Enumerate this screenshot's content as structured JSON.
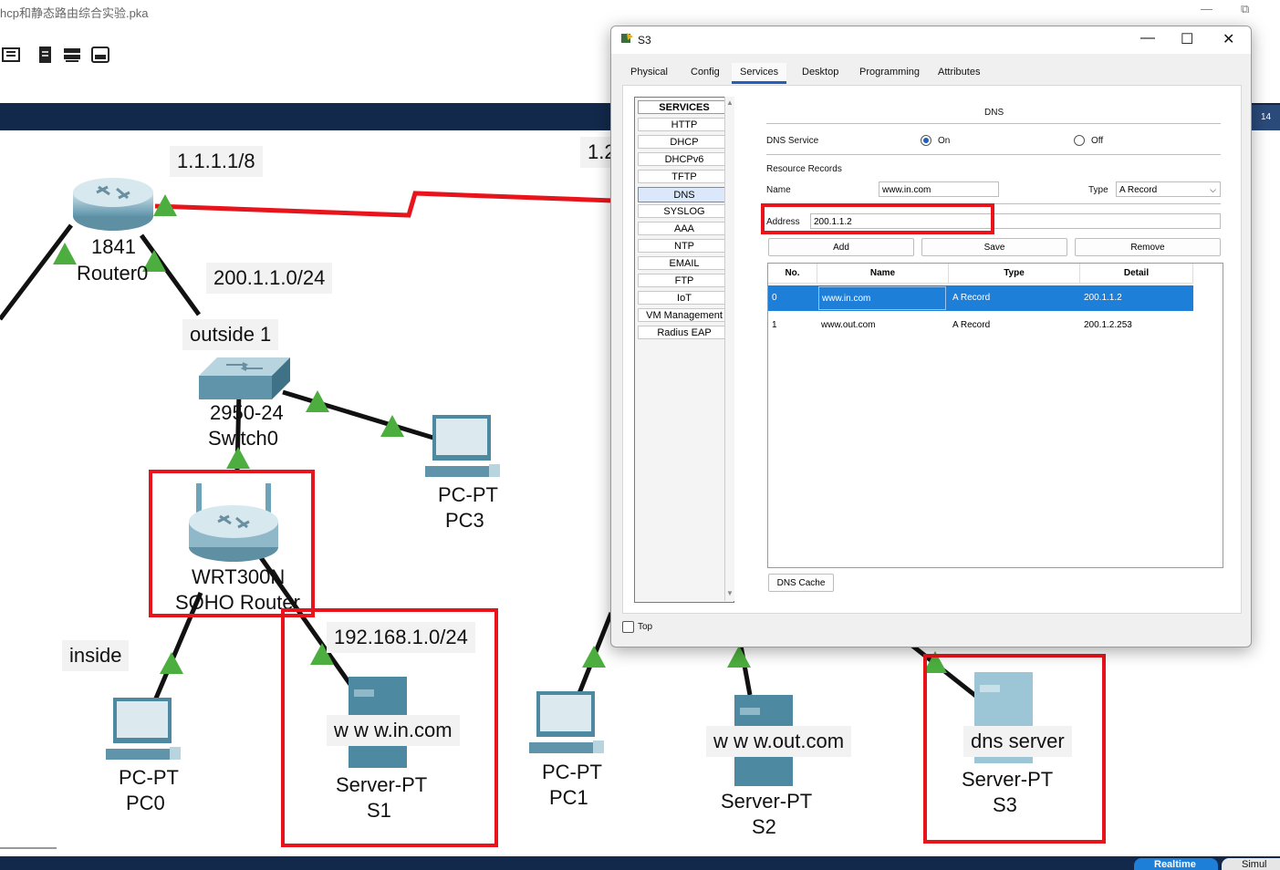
{
  "app": {
    "title": "hcp和静态路由综合实验.pka",
    "minimize": "—",
    "restore": "⧉"
  },
  "workspace": {
    "labels": {
      "net_1_1_1": "1.1.1.1/8",
      "net_1_2_partial": "1.2",
      "net_200": "200.1.1.0/24",
      "outside": "outside 1",
      "inside": "inside",
      "net_192": "192.168.1.0/24",
      "www_in": "w w w.in.com",
      "www_out": "w w w.out.com",
      "dns_server": "dns server"
    },
    "devices": {
      "router0": {
        "model": "1841",
        "name": "Router0"
      },
      "switch0": {
        "model": "2950-24",
        "name": "Switch0"
      },
      "soho": {
        "model": "WRT300N",
        "name": "SOHO Router"
      },
      "pc3": {
        "model": "PC-PT",
        "name": "PC3"
      },
      "pc0": {
        "model": "PC-PT",
        "name": "PC0"
      },
      "pc1": {
        "model": "PC-PT",
        "name": "PC1"
      },
      "s1": {
        "model": "Server-PT",
        "name": "S1"
      },
      "s2": {
        "model": "Server-PT",
        "name": "S2"
      },
      "s3": {
        "model": "Server-PT",
        "name": "S3"
      }
    },
    "bottom_tabs": [
      "Realtime",
      "Simul"
    ],
    "clock_partial": "14",
    "colors": {
      "link_red": "#e8141c",
      "link_black": "#111111",
      "port_green": "#4cae3e",
      "band_navy": "#13294b"
    }
  },
  "dialog": {
    "title": "S3",
    "controls": {
      "minimize": "—",
      "maximize": "☐",
      "close": "✕"
    },
    "tabs": [
      "Physical",
      "Config",
      "Services",
      "Desktop",
      "Programming",
      "Attributes"
    ],
    "active_tab": "Services",
    "services_header": "SERVICES",
    "services": [
      "HTTP",
      "DHCP",
      "DHCPv6",
      "TFTP",
      "DNS",
      "SYSLOG",
      "AAA",
      "NTP",
      "EMAIL",
      "FTP",
      "IoT",
      "VM Management",
      "Radius EAP"
    ],
    "selected_service": "DNS",
    "dns": {
      "heading": "DNS",
      "service_label": "DNS Service",
      "on_label": "On",
      "off_label": "Off",
      "service_state": "On",
      "resource_records_label": "Resource Records",
      "name_label": "Name",
      "name_value": "www.in.com",
      "type_label": "Type",
      "type_value": "A Record",
      "address_label": "Address",
      "address_value": "200.1.1.2",
      "buttons": {
        "add": "Add",
        "save": "Save",
        "remove": "Remove"
      },
      "columns": [
        "No.",
        "Name",
        "Type",
        "Detail"
      ],
      "records": [
        {
          "no": "0",
          "name": "www.in.com",
          "type": "A Record",
          "detail": "200.1.1.2"
        },
        {
          "no": "1",
          "name": "www.out.com",
          "type": "A Record",
          "detail": "200.1.2.253"
        }
      ],
      "cache_button": "DNS Cache"
    },
    "top_checkbox_label": "Top"
  }
}
